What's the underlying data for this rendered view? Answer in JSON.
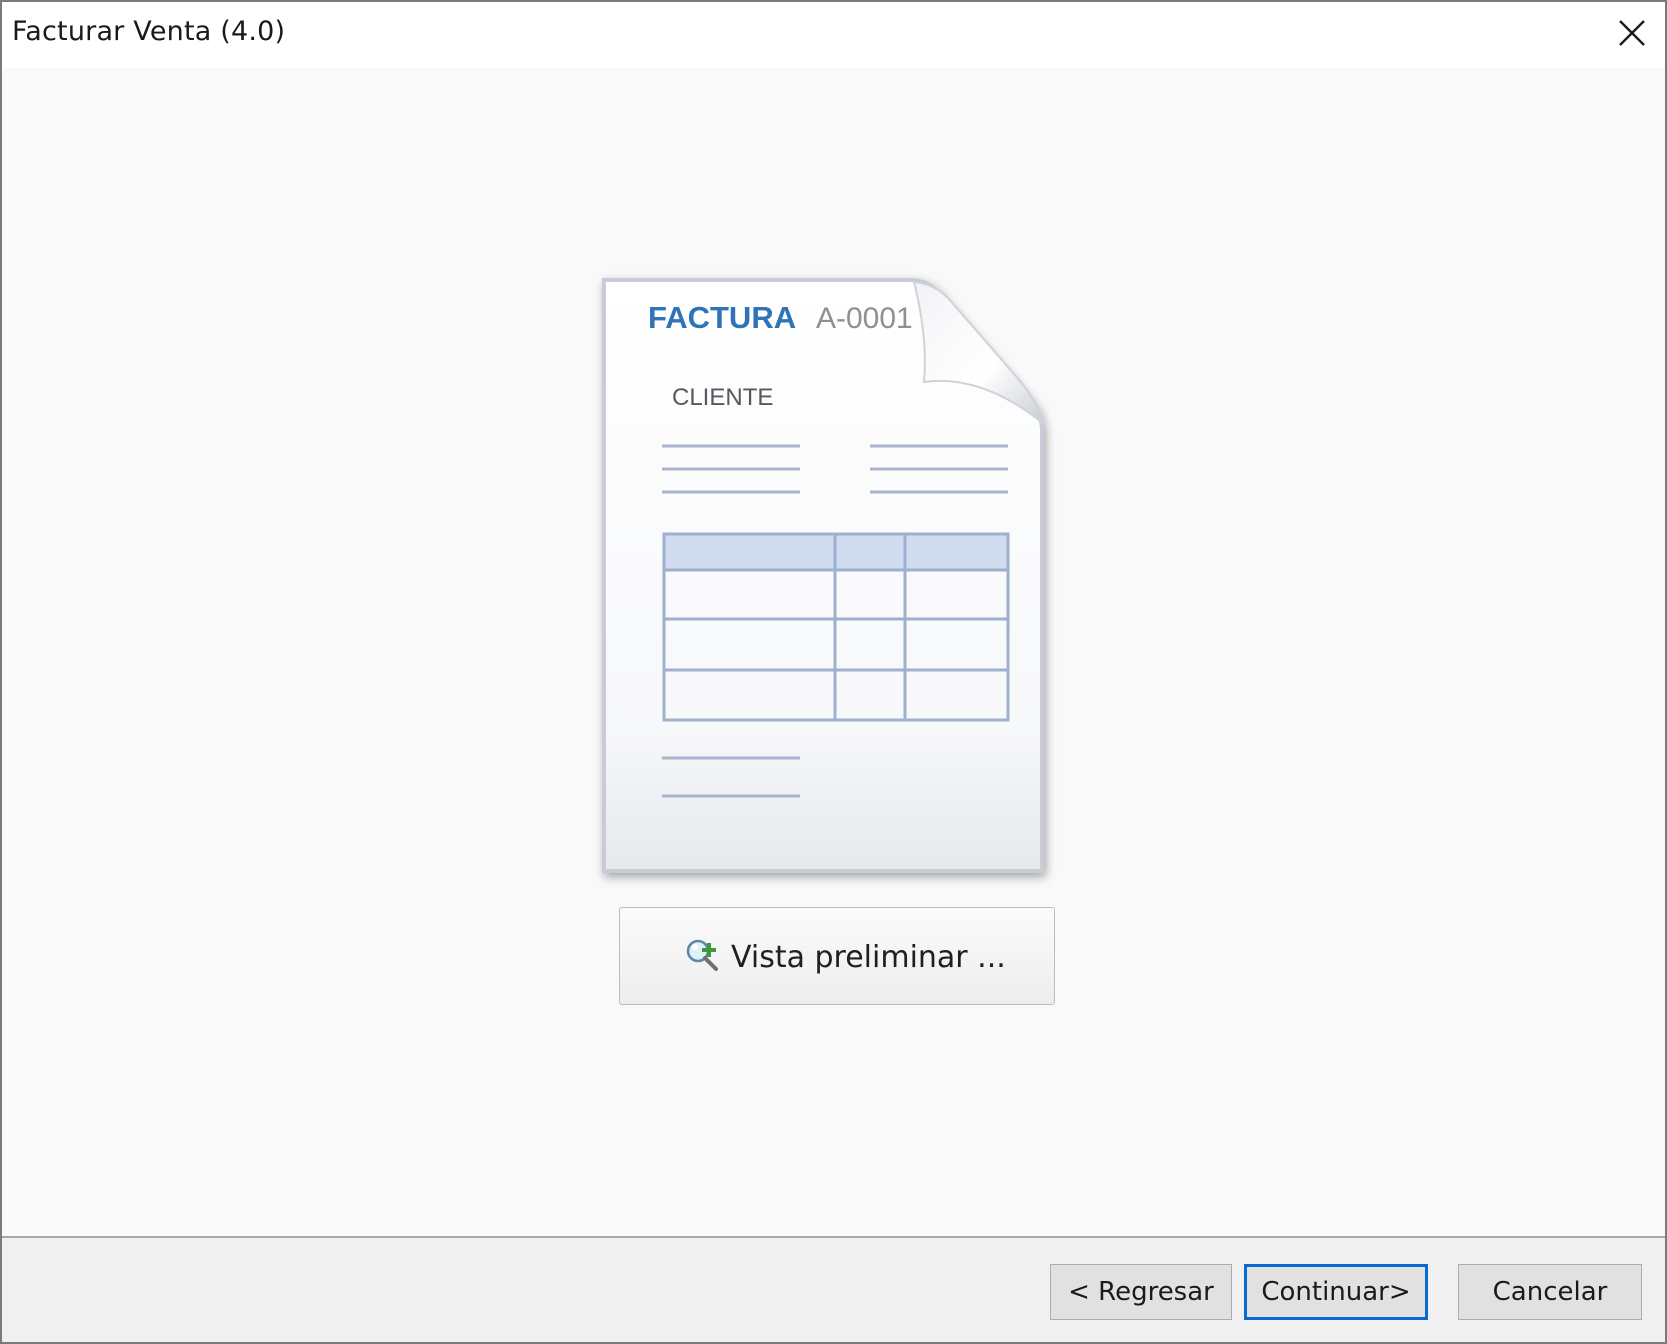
{
  "window": {
    "title": "Facturar Venta (4.0)",
    "close_icon": "close-icon"
  },
  "illustration": {
    "doc_title": "FACTURA",
    "doc_number": "A-0001",
    "client_label": "CLIENTE",
    "accent_color": "#2f74b7"
  },
  "preview_button": {
    "icon": "magnifier-plus-icon",
    "label": "Vista preliminar ..."
  },
  "footer": {
    "back_label": "< Regresar",
    "next_label": "Continuar>",
    "cancel_label": "Cancelar",
    "focus_color": "#0a6ad0"
  }
}
